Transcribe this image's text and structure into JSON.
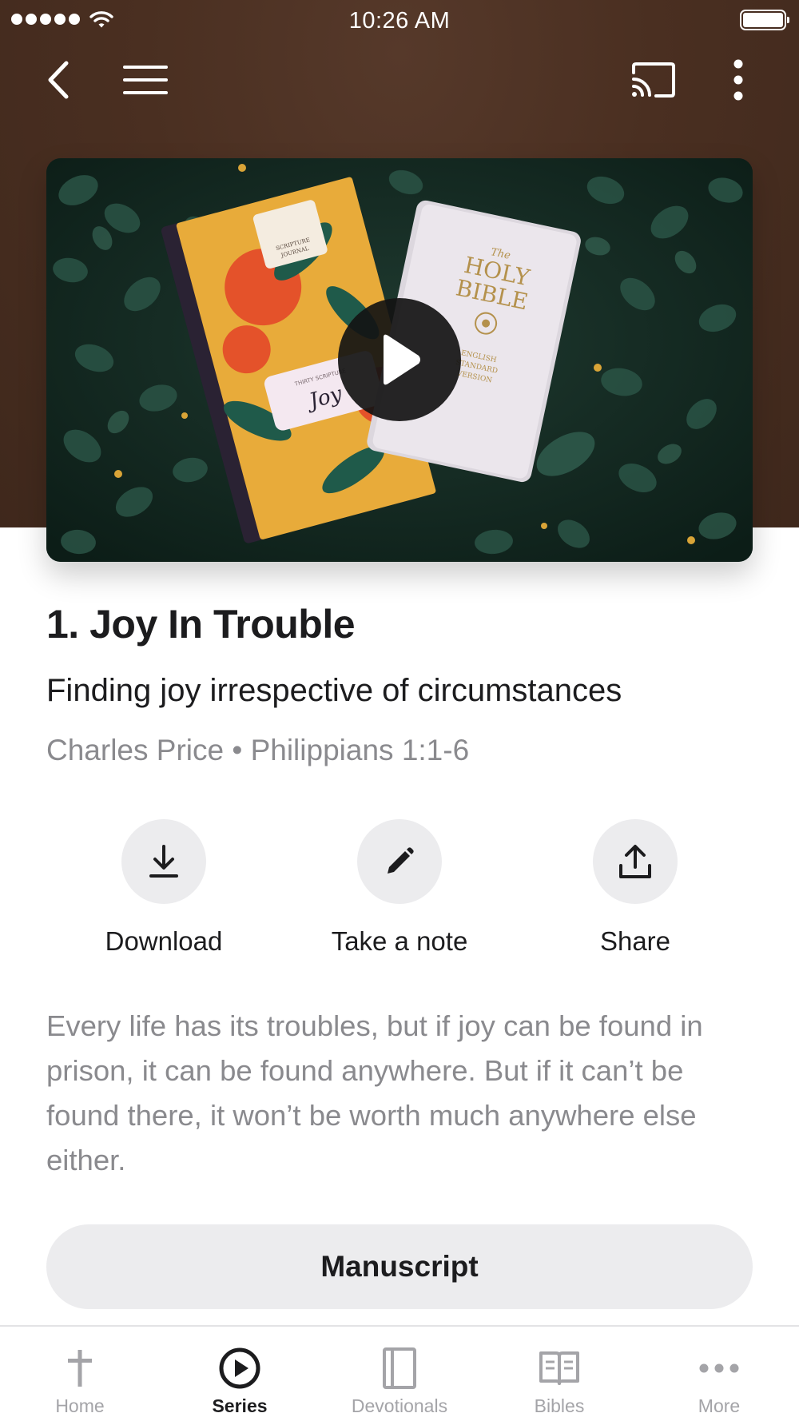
{
  "status_bar": {
    "time": "10:26 AM"
  },
  "header": {
    "back_icon": "chevron-left-icon",
    "menu_icon": "hamburger-icon",
    "cast_icon": "cast-icon",
    "more_icon": "vertical-dots-icon"
  },
  "video": {
    "play_icon": "play-icon",
    "journal_cover_text": [
      "SCRIPTURE",
      "JOURNAL"
    ],
    "journal_label_text": "THIRTY SCRIPTURE",
    "journal_script": "Joy",
    "bible_title": [
      "The",
      "HOLY",
      "BIBLE"
    ],
    "bible_subtitle": [
      "ENGLISH",
      "STANDARD",
      "VERSION"
    ]
  },
  "sermon": {
    "title": "1. Joy In Trouble",
    "subtitle": "Finding joy irrespective of circumstances",
    "meta": "Charles Price • Philippians 1:1-6",
    "description": "Every life has its troubles, but if joy can be found in prison, it can be found anywhere. But if it can’t be found there, it won’t be worth much anywhere else either."
  },
  "actions": [
    {
      "label": "Download",
      "icon": "download-icon"
    },
    {
      "label": "Take a note",
      "icon": "pencil-icon"
    },
    {
      "label": "Share",
      "icon": "share-icon"
    }
  ],
  "manuscript_label": "Manuscript",
  "tabs": [
    {
      "label": "Home",
      "icon": "cross-icon",
      "active": false
    },
    {
      "label": "Series",
      "icon": "play-circle-icon",
      "active": true
    },
    {
      "label": "Devotionals",
      "icon": "book-closed-icon",
      "active": false
    },
    {
      "label": "Bibles",
      "icon": "book-open-icon",
      "active": false
    },
    {
      "label": "More",
      "icon": "horizontal-dots-icon",
      "active": false
    }
  ],
  "colors": {
    "header_bg": "#4a2f21",
    "text_primary": "#1c1c1e",
    "text_secondary": "#8a8a8e",
    "button_bg": "#ececee",
    "tab_inactive": "#a4a4a8"
  }
}
